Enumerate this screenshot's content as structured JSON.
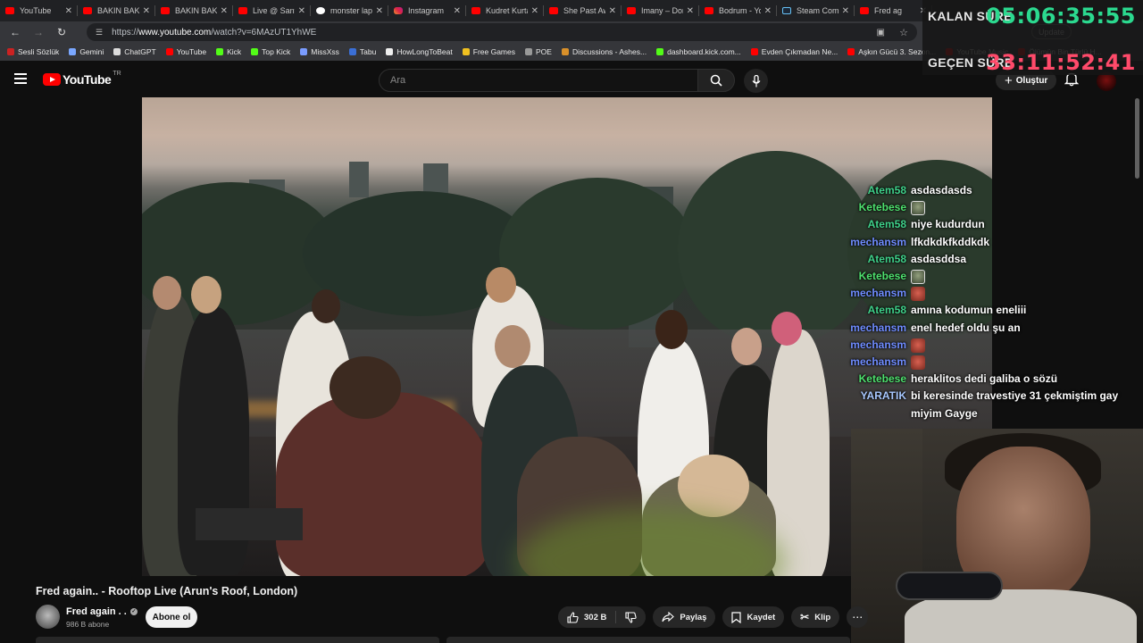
{
  "browser": {
    "tabs": [
      {
        "title": "YouTube",
        "icon": "youtube-icon"
      },
      {
        "title": "BAKIN BAKIN",
        "icon": "youtube-icon"
      },
      {
        "title": "BAKIN BAKIN",
        "icon": "youtube-icon"
      },
      {
        "title": "Live @ Santa",
        "icon": "youtube-icon"
      },
      {
        "title": "monster lapt",
        "icon": "google-icon"
      },
      {
        "title": "Instagram",
        "icon": "instagram-icon"
      },
      {
        "title": "Kudret Kurta",
        "icon": "youtube-icon"
      },
      {
        "title": "She Past Awa",
        "icon": "youtube-icon"
      },
      {
        "title": "Imany – Don",
        "icon": "youtube-icon"
      },
      {
        "title": "Bodrum - You",
        "icon": "youtube-icon"
      },
      {
        "title": "Steam Comm",
        "icon": "steam-icon"
      },
      {
        "title": "Fred ag",
        "icon": "youtube-icon"
      }
    ],
    "url_prefix": "https://",
    "url_host": "www.youtube.com",
    "url_path": "/watch?v=6MAzUT1YhWE",
    "update_label": "Update",
    "bookmarks": [
      {
        "label": "Sesli Sözlük",
        "color": "#cc2222"
      },
      {
        "label": "Gemini",
        "color": "#7aa7ff"
      },
      {
        "label": "ChatGPT",
        "color": "#dddddd"
      },
      {
        "label": "YouTube",
        "color": "#ff0000"
      },
      {
        "label": "Kick",
        "color": "#53fc18"
      },
      {
        "label": "Top Kick",
        "color": "#53fc18"
      },
      {
        "label": "MissXss",
        "color": "#7a9cff"
      },
      {
        "label": "Tabu",
        "color": "#3b6fd6"
      },
      {
        "label": "HowLongToBeat",
        "color": "#eeeeee"
      },
      {
        "label": "Free Games",
        "color": "#f0c020"
      },
      {
        "label": "POE",
        "color": "#999999"
      },
      {
        "label": "Discussions - Ashes...",
        "color": "#d9902a"
      },
      {
        "label": "dashboard.kick.com...",
        "color": "#53fc18"
      },
      {
        "label": "Evden Çıkmadan Ne...",
        "color": "#ff0000"
      },
      {
        "label": "Aşkın Gücü 3. Sezon...",
        "color": "#ff0000"
      },
      {
        "label": "YouTube Music",
        "color": "#ff0000"
      },
      {
        "label": "Ölümün Bin Türlü H...",
        "color": "#ff0000"
      }
    ]
  },
  "timer": {
    "remaining_label": "KALAN SÜRE",
    "remaining_value": "05:06:35:55",
    "elapsed_label": "GEÇEN SÜRE",
    "elapsed_value": "33:11:52:41"
  },
  "youtube": {
    "logo_text": "YouTube",
    "country_code": "TR",
    "search_placeholder": "Ara",
    "create_label": "Oluştur",
    "video_title": "Fred again.. - Rooftop Live (Arun's Roof, London)",
    "channel_name": "Fred again . .",
    "subscribers": "986 B abone",
    "subscribe_label": "Abone ol",
    "likes": "302 B",
    "share_label": "Paylaş",
    "save_label": "Kaydet",
    "clip_label": "Klip"
  },
  "chat": [
    {
      "user": "Atem58",
      "color": "#3fd18a",
      "text": "asdasdasds"
    },
    {
      "user": "Ketebese",
      "color": "#4ee06e",
      "text": "",
      "emote": "frog"
    },
    {
      "user": "Atem58",
      "color": "#3fd18a",
      "text": "niye kudurdun"
    },
    {
      "user": "mechansm",
      "color": "#6f8cff",
      "text": "lfkdkdkfkddkdk"
    },
    {
      "user": "Atem58",
      "color": "#3fd18a",
      "text": "asdasddsa"
    },
    {
      "user": "Ketebese",
      "color": "#4ee06e",
      "text": "",
      "emote": "frog"
    },
    {
      "user": "mechansm",
      "color": "#6f8cff",
      "text": "",
      "emote": "face"
    },
    {
      "user": "Atem58",
      "color": "#3fd18a",
      "text": "amına kodumun eneliii"
    },
    {
      "user": "mechansm",
      "color": "#6f8cff",
      "text": "enel hedef oldu şu an"
    },
    {
      "user": "mechansm",
      "color": "#6f8cff",
      "text": "",
      "emote": "face"
    },
    {
      "user": "mechansm",
      "color": "#6f8cff",
      "text": "",
      "emote": "face"
    },
    {
      "user": "Ketebese",
      "color": "#4ee06e",
      "text": "heraklitos dedi galiba o sözü"
    },
    {
      "user": "YARATIK",
      "color": "#a8c8ff",
      "text": "bi keresinde travestiye 31 çekmiştim gay miyim Gayge"
    }
  ]
}
